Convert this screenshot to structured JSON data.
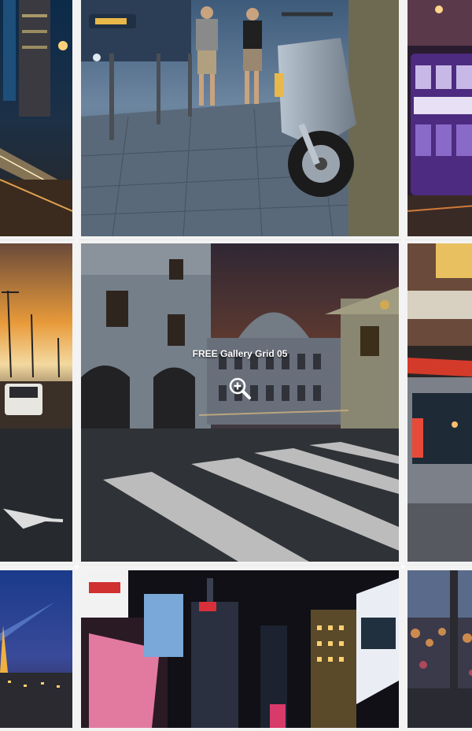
{
  "gallery": {
    "hover_caption": "FREE Gallery Grid 05",
    "zoom_icon": "zoom-in-icon",
    "tiles": [
      {
        "scene": "city-highway-night"
      },
      {
        "scene": "street-scooter-rain"
      },
      {
        "scene": "purple-tram"
      },
      {
        "scene": "sunset-road"
      },
      {
        "scene": "colonial-crosswalk"
      },
      {
        "scene": "taxi-close-up"
      },
      {
        "scene": "eiffel-night"
      },
      {
        "scene": "times-square-night"
      },
      {
        "scene": "street-bokeh"
      }
    ]
  }
}
